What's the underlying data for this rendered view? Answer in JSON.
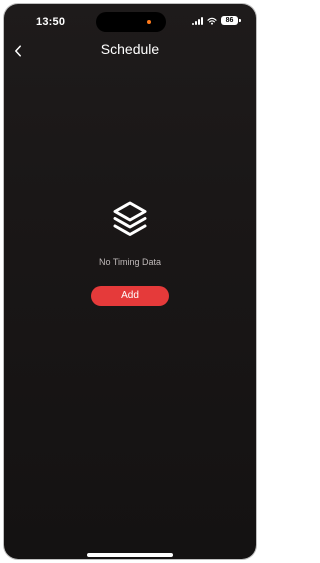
{
  "status_bar": {
    "time": "13:50",
    "battery": "86",
    "island_indicator_color": "#ff7a1a"
  },
  "navigation": {
    "back_icon": "chevron-left-icon",
    "title": "Schedule"
  },
  "empty_state": {
    "icon": "layers-icon",
    "message": "No Timing Data",
    "add_label": "Add"
  },
  "colors": {
    "background_top": "#1e1b1b",
    "background_bottom": "#141212",
    "accent": "#e53a3a",
    "text_primary": "#ffffff",
    "text_secondary": "#bfb9b9"
  }
}
